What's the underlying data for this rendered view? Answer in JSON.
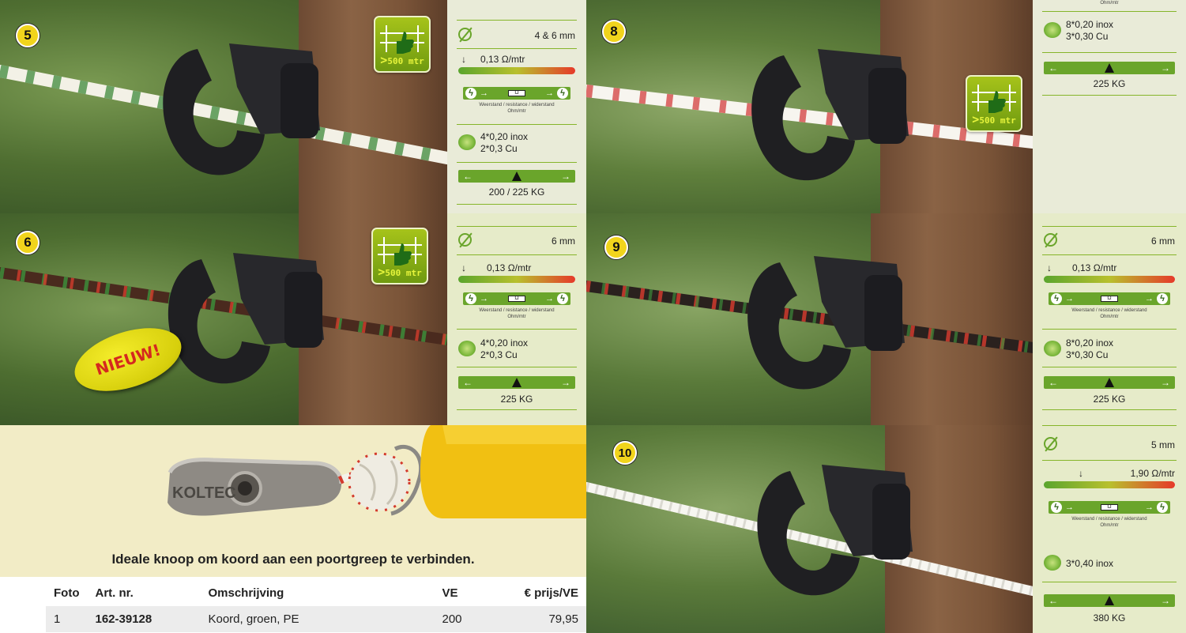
{
  "colors": {
    "accent_green": "#6aa52b",
    "badge_yellow": "#f1d41c",
    "caption_bg": "#f2ecc6"
  },
  "badge_label": {
    "gt": ">",
    "text": "500 mtr"
  },
  "panels": [
    {
      "number": "5",
      "diameter": "4 & 6 mm",
      "resistance": "0,13 Ω/mtr",
      "resistance_note": "Weerstand / resistance / widerstand",
      "resistance_unit": "Ohm/mtr",
      "strands": [
        "4*0,20  inox",
        "2*0,3     Cu"
      ],
      "breaking_load": "200 / 225 KG"
    },
    {
      "number": "8",
      "resistance_unit": "Ohm/mtr",
      "strands": [
        "8*0,20  inox",
        "3*0,30   Cu"
      ],
      "breaking_load": "225 KG"
    },
    {
      "number": "6",
      "diameter": "6 mm",
      "resistance": "0,13 Ω/mtr",
      "resistance_note": "Weerstand / resistance / widerstand",
      "resistance_unit": "Ohm/mtr",
      "strands": [
        "4*0,20  inox",
        "2*0,3     Cu"
      ],
      "breaking_load": "225 KG",
      "new_label": "NIEUW!"
    },
    {
      "number": "9",
      "diameter": "6 mm",
      "resistance": "0,13 Ω/mtr",
      "resistance_note": "Weerstand / resistance / widerstand",
      "resistance_unit": "Ohm/mtr",
      "strands": [
        "8*0,20  inox",
        "3*0,30   Cu"
      ],
      "breaking_load": "225 KG"
    },
    {
      "number": "10",
      "diameter": "5 mm",
      "resistance": "1,90 Ω/mtr",
      "resistance_note": "Weerstand / resistance / widerstand",
      "resistance_unit": "Ohm/mtr",
      "strands": [
        "3*0,40  inox"
      ],
      "breaking_load": "380 KG"
    }
  ],
  "knot": {
    "caption": "Ideale knoop  om koord aan een poortgreep te verbinden.",
    "brand_text": "KOLTEC"
  },
  "price_table": {
    "headers": [
      "Foto",
      "Art. nr.",
      "Omschrijving",
      "VE",
      "€ prijs/VE"
    ],
    "rows": [
      [
        "1",
        "162-39128",
        "Koord, groen,  PE",
        "200",
        "79,95"
      ]
    ]
  }
}
